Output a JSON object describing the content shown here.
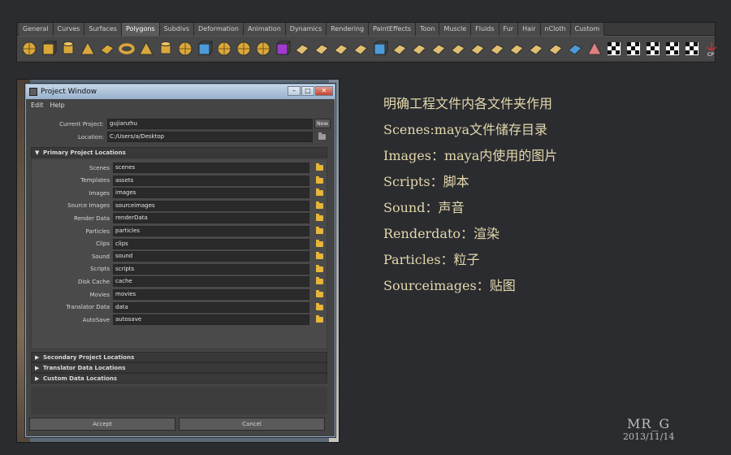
{
  "shelf": {
    "tabs": [
      "General",
      "Curves",
      "Surfaces",
      "Polygons",
      "Subdivs",
      "Deformation",
      "Animation",
      "Dynamics",
      "Rendering",
      "PaintEffects",
      "Toon",
      "Muscle",
      "Fluids",
      "Fur",
      "Hair",
      "nCloth",
      "Custom"
    ],
    "active_tab": "Polygons",
    "last_icon_label": "CP"
  },
  "window": {
    "title": "Project Window",
    "menu": [
      "Edit",
      "Help"
    ],
    "current_project_label": "Current Project:",
    "current_project_value": "gujianzhu",
    "new_button": "New",
    "location_label": "Location:",
    "location_value": "C:/Users/a/Desktop",
    "primary_section": "Primary Project Locations",
    "rows": [
      {
        "label": "Scenes",
        "value": "scenes"
      },
      {
        "label": "Templates",
        "value": "assets"
      },
      {
        "label": "Images",
        "value": "images"
      },
      {
        "label": "Source Images",
        "value": "sourceimages"
      },
      {
        "label": "Render Data",
        "value": "renderData"
      },
      {
        "label": "Particles",
        "value": "particles"
      },
      {
        "label": "Clips",
        "value": "clips"
      },
      {
        "label": "Sound",
        "value": "sound"
      },
      {
        "label": "Scripts",
        "value": "scripts"
      },
      {
        "label": "Disk Cache",
        "value": "cache"
      },
      {
        "label": "Movies",
        "value": "movies"
      },
      {
        "label": "Translator Data",
        "value": "data"
      },
      {
        "label": "AutoSave",
        "value": "autosave"
      }
    ],
    "collapsed_sections": [
      "Secondary Project Locations",
      "Translator Data Locations",
      "Custom Data Locations"
    ],
    "accept_button": "Accept",
    "cancel_button": "Cancel"
  },
  "notes": [
    "明确工程文件内各文件夹作用",
    "Scenes:maya文件储存目录",
    "Images：maya内使用的图片",
    "Scripts：脚本",
    "Sound：声音",
    "Renderdato：渲染",
    "Particles：粒子",
    "Sourceimages：贴图"
  ],
  "signature": {
    "name": "MR_G",
    "date": "2013/11/14"
  },
  "colors": {
    "note_text": "#e3d8ab",
    "folder": "#e6b63b",
    "background": "#2b2c30"
  }
}
